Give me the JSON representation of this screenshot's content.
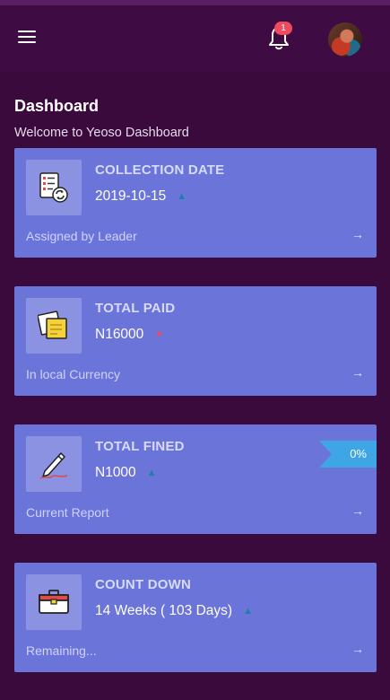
{
  "header": {
    "notification_count": "1",
    "menu_icon": "hamburger-menu-icon",
    "bell_icon": "bell-icon"
  },
  "page": {
    "title": "Dashboard",
    "subtitle": "Welcome to Yeoso Dashboard"
  },
  "cards": [
    {
      "title": "COLLECTION DATE",
      "value": "2019-10-15",
      "trend": "up",
      "trend_glyph": "▲",
      "footer": "Assigned by Leader",
      "icon": "checklist-sync-icon"
    },
    {
      "title": "TOTAL PAID",
      "value": "N16000",
      "trend": "down",
      "trend_glyph": "▼",
      "footer": "In local Currency",
      "icon": "sticky-notes-icon"
    },
    {
      "title": "TOTAL FINED",
      "value": "N1000",
      "trend": "up",
      "trend_glyph": "▲",
      "footer": "Current Report",
      "icon": "pen-signature-icon",
      "ribbon": "0%"
    },
    {
      "title": "COUNT DOWN",
      "value": "14 Weeks ( 103 Days)",
      "trend": "up",
      "trend_glyph": "▲",
      "footer": "Remaining...",
      "icon": "briefcase-icon"
    }
  ],
  "arrow_glyph": "→",
  "colors": {
    "background": "#3a0a3d",
    "card": "#6b74d8",
    "badge": "#ef4a5d",
    "ribbon": "#3fa6e6",
    "trend_up": "#1d7fa6",
    "trend_down": "#e0506a"
  }
}
